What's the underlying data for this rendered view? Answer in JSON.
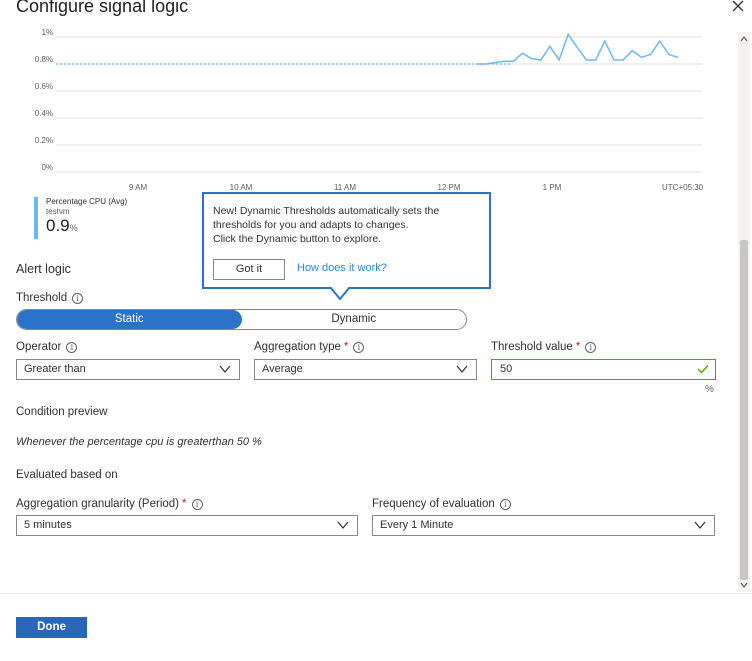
{
  "title": "Configure signal logic",
  "chart_data": {
    "type": "line",
    "y_ticks": [
      "1%",
      "0.8%",
      "0.6%",
      "0.4%",
      "0.2%",
      "0%"
    ],
    "x_ticks": [
      "9 AM",
      "10 AM",
      "11 AM",
      "12 PM",
      "1 PM"
    ],
    "timezone": "UTC+05:30",
    "threshold_line": 0.8,
    "ylim": [
      0,
      1
    ],
    "series": [
      {
        "values": [
          0.8,
          0.8,
          0.8,
          0.8,
          0.8,
          0.8,
          0.8,
          0.8,
          0.8,
          0.8,
          0.8,
          0.8,
          0.8,
          0.8,
          0.8,
          0.8,
          0.8,
          0.8,
          0.8,
          0.8,
          0.8,
          0.8,
          0.8,
          0.8,
          0.8,
          0.8,
          0.8,
          0.8,
          0.8,
          0.8,
          0.8,
          0.8,
          0.8,
          0.8,
          0.8,
          0.8,
          0.8,
          0.8,
          0.8,
          0.8,
          0.8,
          0.8,
          0.8,
          0.8,
          0.8,
          0.8,
          0.8,
          0.8,
          0.81,
          0.82,
          0.82,
          0.88,
          0.84,
          0.83,
          0.93,
          0.83,
          1.02,
          0.92,
          0.83,
          0.83,
          0.97,
          0.83,
          0.83,
          0.9,
          0.85,
          0.87,
          0.97,
          0.87,
          0.85
        ]
      }
    ]
  },
  "metric": {
    "name": "Percentage CPU (Avg)",
    "resource": "testvm",
    "value": "0.9",
    "unit": "%"
  },
  "callout": {
    "line1": "New! Dynamic Thresholds automatically sets the",
    "line2": "thresholds for you and adapts to changes.",
    "line3": "Click the Dynamic button to explore.",
    "got_it": "Got it",
    "how": "How does it work?"
  },
  "alert_logic": "Alert logic",
  "threshold": {
    "label": "Threshold",
    "static": "Static",
    "dynamic": "Dynamic"
  },
  "operator": {
    "label": "Operator",
    "value": "Greater than"
  },
  "aggregation_type": {
    "label": "Aggregation type",
    "value": "Average"
  },
  "threshold_value": {
    "label": "Threshold value",
    "value": "50",
    "unit": "%"
  },
  "condition_preview": {
    "title": "Condition preview",
    "text": "Whenever the percentage cpu is greaterthan 50 %"
  },
  "evaluated": "Evaluated based on",
  "granularity": {
    "label": "Aggregation granularity (Period)",
    "value": "5 minutes"
  },
  "frequency": {
    "label": "Frequency of evaluation",
    "value": "Every 1 Minute"
  },
  "required_mark": "*",
  "info_glyph": "i",
  "done": "Done",
  "colors": {
    "accent": "#2a73c9",
    "line": "#6cb8f1",
    "valid": "#57a300"
  }
}
